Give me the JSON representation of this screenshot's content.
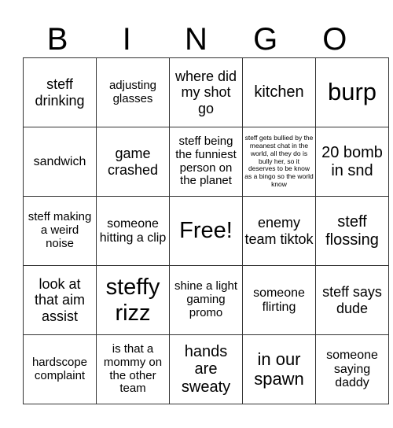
{
  "header": {
    "letters": [
      "B",
      "I",
      "N",
      "G",
      "O"
    ]
  },
  "cells": [
    [
      "steff drinking",
      "adjusting glasses",
      "where did my shot go",
      "kitchen",
      "burp"
    ],
    [
      "sandwich",
      "game crashed",
      "steff being the funniest person on the planet",
      "steff gets bullied by the meanest chat in the world, all they do is bully her, so it deserves to be know as a bingo so the world know",
      "20 bomb in snd"
    ],
    [
      "steff making a weird noise",
      "someone hitting a clip",
      "Free!",
      "enemy team tiktok",
      "steff flossing"
    ],
    [
      "look at that aim assist",
      "steffy rizz",
      "shine a light gaming promo",
      "someone flirting",
      "steff says dude"
    ],
    [
      "hardscope complaint",
      "is that a mommy on the other team",
      "hands are sweaty",
      "in our spawn",
      "someone saying daddy"
    ]
  ]
}
